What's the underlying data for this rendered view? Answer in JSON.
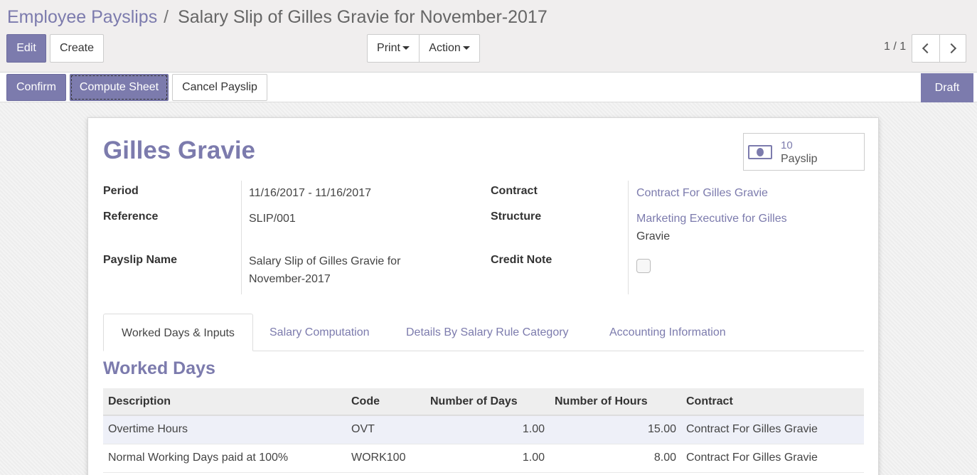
{
  "breadcrumb": {
    "parent": "Employee Payslips",
    "separator": "/",
    "current": "Salary Slip of Gilles Gravie for November-2017"
  },
  "toolbar": {
    "edit_label": "Edit",
    "create_label": "Create",
    "print_label": "Print",
    "action_label": "Action",
    "pager": "1 / 1"
  },
  "statusbar": {
    "confirm_label": "Confirm",
    "compute_label": "Compute Sheet",
    "cancel_label": "Cancel Payslip",
    "state": "Draft"
  },
  "colors": {
    "accent": "#7c7bad"
  },
  "sheet": {
    "employee": "Gilles Gravie",
    "smart_button": {
      "count": "10",
      "label": "Payslip",
      "icon": "money-icon"
    },
    "fields": {
      "period_label": "Period",
      "period_value": "11/16/2017 - 11/16/2017",
      "reference_label": "Reference",
      "reference_value": "SLIP/001",
      "payslip_name_label": "Payslip Name",
      "payslip_name_line1": "Salary Slip of Gilles Gravie for",
      "payslip_name_line2": "November-2017",
      "contract_label": "Contract",
      "contract_value": "Contract For Gilles Gravie",
      "structure_label": "Structure",
      "structure_value_line1": "Marketing Executive for Gilles",
      "structure_value_line2": "Gravie",
      "credit_note_label": "Credit Note",
      "credit_note_checked": false
    },
    "tabs": [
      {
        "label": "Worked Days & Inputs",
        "active": true
      },
      {
        "label": "Salary Computation",
        "active": false
      },
      {
        "label": "Details By Salary Rule Category",
        "active": false
      },
      {
        "label": "Accounting Information",
        "active": false
      }
    ],
    "section_title": "Worked Days",
    "table": {
      "columns": [
        "Description",
        "Code",
        "Number of Days",
        "Number of Hours",
        "Contract"
      ],
      "rows": [
        [
          "Overtime Hours",
          "OVT",
          "1.00",
          "15.00",
          "Contract For Gilles Gravie"
        ],
        [
          "Normal Working Days paid at 100%",
          "WORK100",
          "1.00",
          "8.00",
          "Contract For Gilles Gravie"
        ]
      ]
    }
  }
}
